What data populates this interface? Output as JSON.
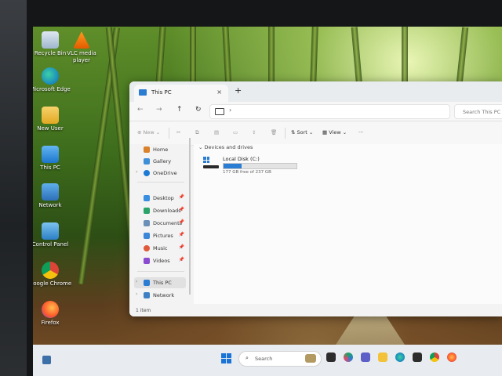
{
  "desktop": {
    "icons": [
      {
        "label": "Recycle Bin"
      },
      {
        "label": "VLC media player"
      },
      {
        "label": "Microsoft Edge"
      },
      {
        "label": "New User"
      },
      {
        "label": "This PC"
      },
      {
        "label": "Network"
      },
      {
        "label": "Control Panel"
      },
      {
        "label": "Google Chrome"
      },
      {
        "label": "Firefox"
      }
    ]
  },
  "explorer": {
    "tab_title": "This PC",
    "tab_close": "×",
    "tab_add": "+",
    "nav": {
      "back": "←",
      "forward": "→",
      "up": "↑",
      "refresh": "↻",
      "chevron": "›"
    },
    "search_placeholder": "Search This PC",
    "toolbar": {
      "new_label": "New",
      "sort_label": "Sort",
      "view_label": "View",
      "more_label": "···"
    },
    "sidebar": {
      "items": [
        {
          "label": "Home"
        },
        {
          "label": "Gallery"
        },
        {
          "label": "OneDrive"
        },
        {
          "label": "Desktop"
        },
        {
          "label": "Downloads"
        },
        {
          "label": "Documents"
        },
        {
          "label": "Pictures"
        },
        {
          "label": "Music"
        },
        {
          "label": "Videos"
        },
        {
          "label": "This PC"
        },
        {
          "label": "Network"
        }
      ]
    },
    "content": {
      "group_header": "Devices and drives",
      "drives": [
        {
          "name": "Local Disk (C:)",
          "free_text": "177 GB free of 237 GB",
          "used_fraction": 0.25
        }
      ]
    },
    "status": "1 item"
  },
  "taskbar": {
    "search_label": "Search"
  }
}
